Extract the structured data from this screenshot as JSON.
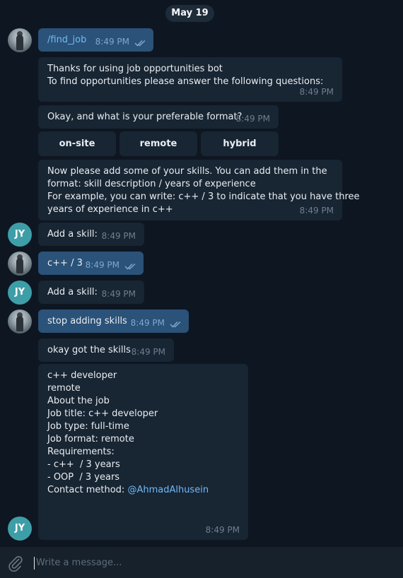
{
  "chat": {
    "date": "May 19",
    "messages": {
      "m1": {
        "text": "/find_job",
        "time": "8:49 PM"
      },
      "m2": {
        "lines": [
          "Thanks for using job opportunities bot",
          "To find opportunities please answer the following questions:"
        ],
        "time": "8:49 PM"
      },
      "m3": {
        "text": "Okay, and what is your preferable format?",
        "time": "8:49 PM"
      },
      "keyboard": [
        "on-site",
        "remote",
        "hybrid"
      ],
      "m4": {
        "lines": [
          "Now please add some of your skills. You can add them in the",
          "format: skill description / years of experience",
          "For example, you can write: c++ / 3 to indicate that you have three",
          "years of experience in c++"
        ],
        "time": "8:49 PM"
      },
      "m5": {
        "text": "Add a skill:",
        "time": "8:49 PM"
      },
      "m6": {
        "text": "c++ / 3",
        "time": "8:49 PM"
      },
      "m7": {
        "text": "Add a skill:",
        "time": "8:49 PM"
      },
      "m8": {
        "text": "stop adding skills",
        "time": "8:49 PM"
      },
      "m9": {
        "text": "okay got the skills",
        "time": "8:49 PM"
      },
      "m10": {
        "lines": [
          "c++ developer",
          "remote",
          "",
          "About the job",
          "Job title: c++ developer",
          "Job type: full-time",
          "Job format: remote",
          "",
          "Requirements:",
          "- c++  / 3 years",
          "- OOP  / 3 years",
          ""
        ],
        "contact_label": "Contact method: ",
        "contact_link": "@AhmadAlhusein",
        "time": "8:49 PM"
      }
    },
    "bot_initials": "JY"
  },
  "composer": {
    "placeholder": "Write a message..."
  },
  "colors": {
    "background": "#0e1621",
    "incoming": "#182533",
    "outgoing": "#2b5278",
    "accent": "#71baf8",
    "avatar": "#3d9ea8"
  },
  "icons": {
    "attach": "paperclip-icon",
    "read": "double-check-icon"
  }
}
